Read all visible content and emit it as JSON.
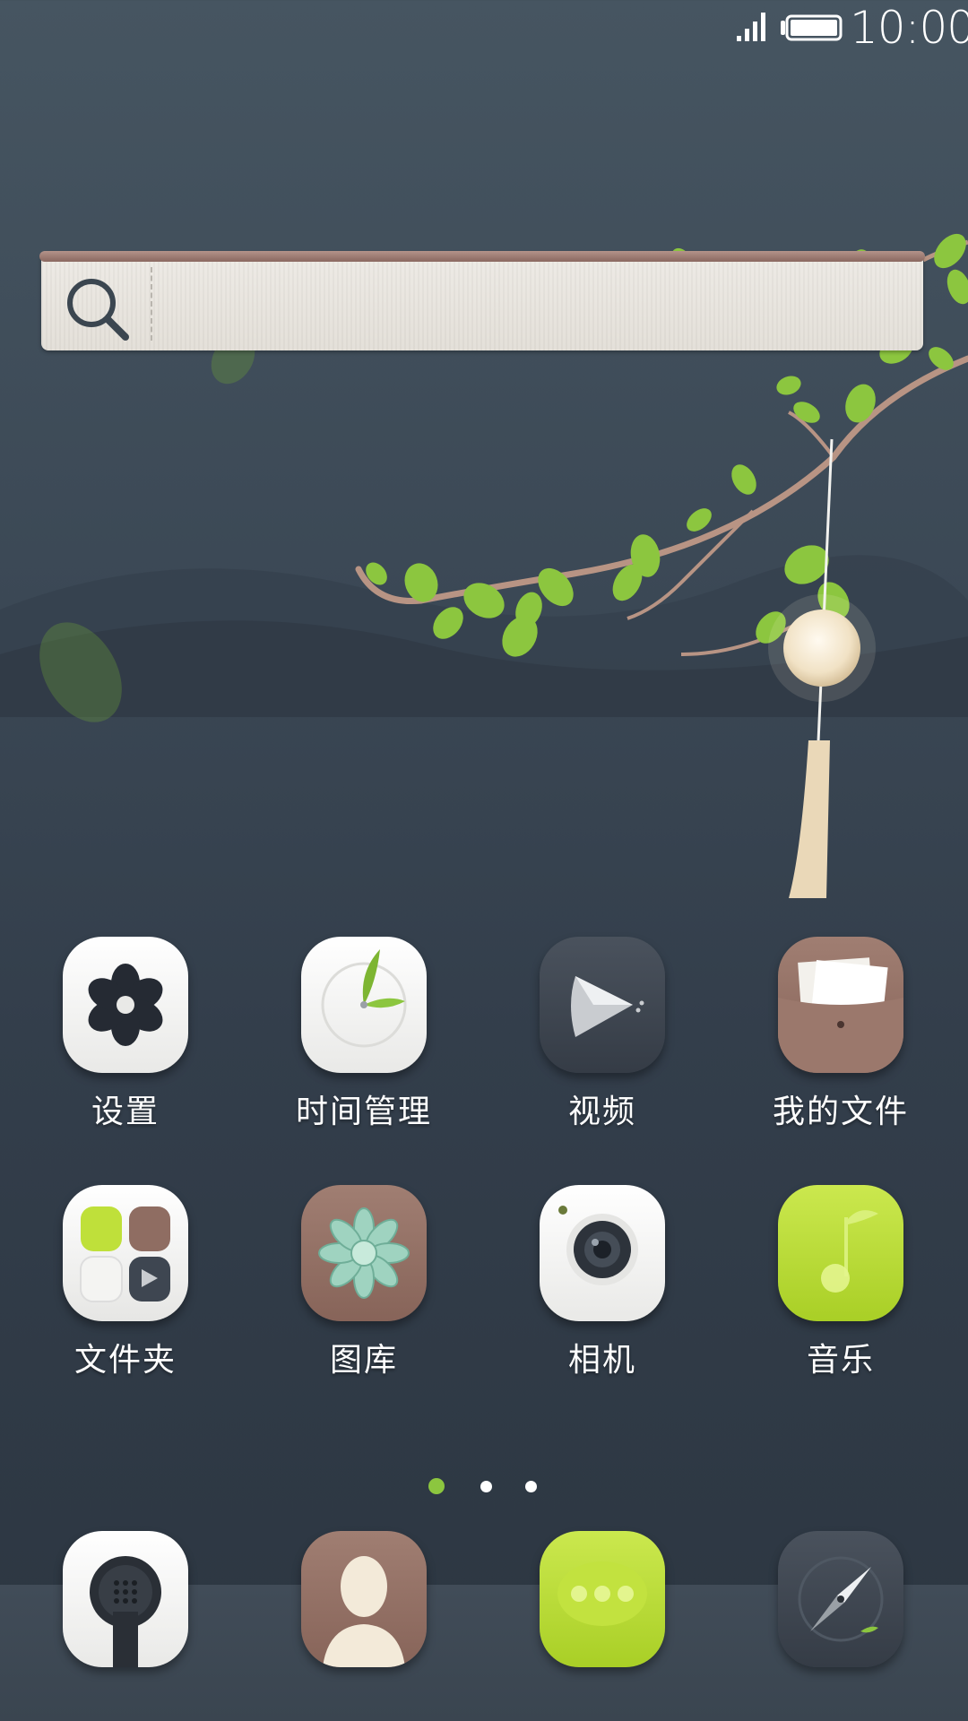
{
  "status_bar": {
    "time": "10:00",
    "signal_icon": "signal-icon",
    "battery_icon": "battery-icon"
  },
  "search_widget": {
    "icon": "search-icon"
  },
  "apps": [
    {
      "label": "设置",
      "icon": "settings-flower-icon"
    },
    {
      "label": "时间管理",
      "icon": "clock-leaf-icon"
    },
    {
      "label": "视频",
      "icon": "video-play-icon"
    },
    {
      "label": "我的文件",
      "icon": "folder-pocket-icon"
    },
    {
      "label": "文件夹",
      "icon": "folder-grid-icon"
    },
    {
      "label": "图库",
      "icon": "gallery-succulent-icon"
    },
    {
      "label": "相机",
      "icon": "camera-icon"
    },
    {
      "label": "音乐",
      "icon": "music-note-icon"
    }
  ],
  "page_indicator": {
    "total_pages": 3,
    "current_page": 1
  },
  "dock": [
    {
      "icon": "phone-icon"
    },
    {
      "icon": "contacts-icon"
    },
    {
      "icon": "messages-icon"
    },
    {
      "icon": "browser-compass-icon"
    }
  ],
  "colors": {
    "accent_green": "#bfe03a",
    "brown": "#8f6d62",
    "dark_tile": "#3e4651",
    "white_tile": "#f4f4f2"
  }
}
